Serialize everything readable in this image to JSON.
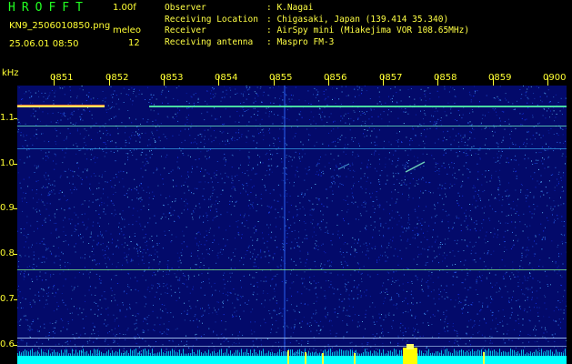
{
  "header": {
    "app_name": "HROFFT",
    "version": "1.00f",
    "file_name": "KN9_2506010850.png",
    "mode": "meleo",
    "count": "12",
    "datetime": "25.06.01 08:50"
  },
  "info": [
    {
      "label": "Observer",
      "value": ": K.Nagai"
    },
    {
      "label": "Receiving Location",
      "value": ": Chigasaki, Japan (139.414 35.340)"
    },
    {
      "label": "Receiver",
      "value": ": AirSpy mini (Miakejima VOR 108.65MHz)"
    },
    {
      "label": "Receiving antenna",
      "value": ": Maspro FM-3"
    }
  ],
  "yaxis": {
    "unit": "kHz",
    "ticks": [
      "1.1",
      "1.0",
      "0.9",
      "0.8",
      "0.7",
      "0.6"
    ]
  },
  "xaxis": {
    "ticks": [
      "0851",
      "0852",
      "0853",
      "0854",
      "0855",
      "0856",
      "0857",
      "0858",
      "0859",
      "0900"
    ]
  },
  "colors": {
    "background": "#000000",
    "spectrogram": "#030a6a",
    "label": "#ffff33",
    "title": "#22ff22",
    "noise_floor": "#00ffff"
  }
}
